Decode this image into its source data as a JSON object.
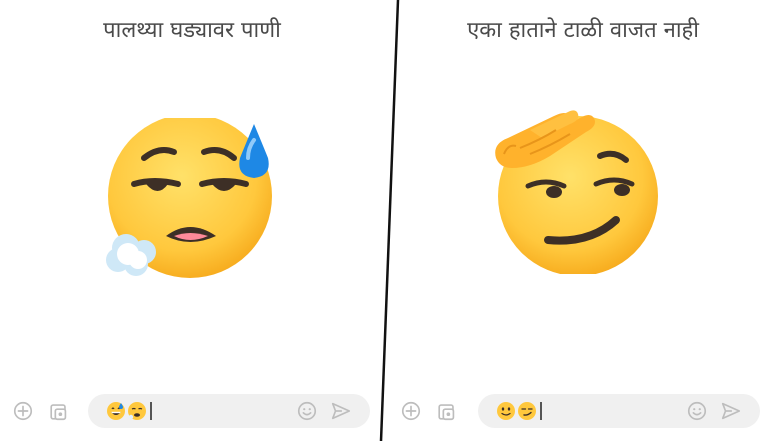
{
  "left_panel": {
    "caption": "पालथ्या घड्यावर पाणी",
    "big_emoji": "downcast-face-with-sweat-and-exhale-icon",
    "draft_emojis": [
      "grinning-face-with-sweat-icon",
      "face-exhaling-icon"
    ]
  },
  "right_panel": {
    "caption": "एका हाताने टाळी वाजत नाही",
    "big_emoji": "smirking-face-with-salute-hand-icon",
    "draft_emojis": [
      "slightly-smiling-face-icon",
      "smirking-face-icon"
    ]
  },
  "composer_icons": [
    "add-icon",
    "gallery-icon",
    "emoji-icon",
    "send-icon"
  ],
  "colors": {
    "emoji_yellow": "#FFC83D",
    "emoji_outline": "#F2A413",
    "feature_dark": "#3d2f26",
    "sweat_blue": "#1e88e5",
    "hand_orange": "#FFB22C",
    "pill_bg": "#f0f0f0",
    "icon_gray": "#bdbdbd",
    "divider": "#111111"
  }
}
